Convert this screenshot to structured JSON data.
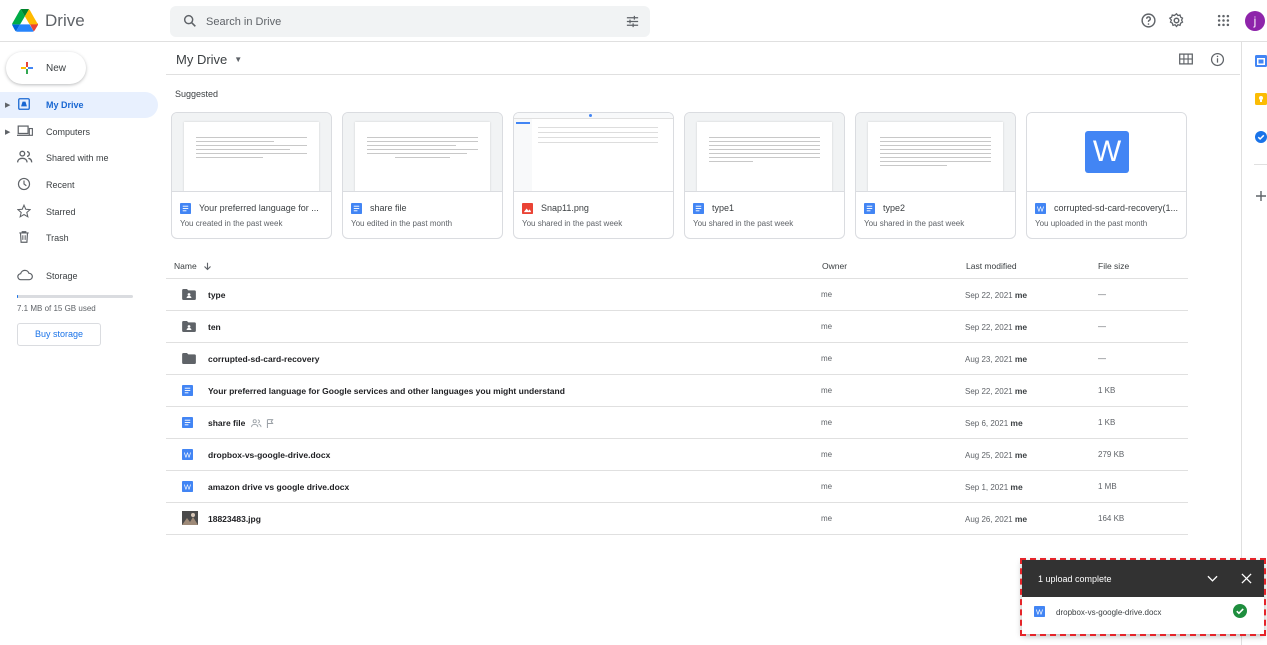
{
  "app": {
    "name": "Drive"
  },
  "search": {
    "placeholder": "Search in Drive"
  },
  "user": {
    "initial": "j"
  },
  "sidebar": {
    "new_label": "New",
    "items": [
      {
        "label": "My Drive"
      },
      {
        "label": "Computers"
      },
      {
        "label": "Shared with me"
      },
      {
        "label": "Recent"
      },
      {
        "label": "Starred"
      },
      {
        "label": "Trash"
      },
      {
        "label": "Storage"
      }
    ],
    "storage_text": "7.1 MB of 15 GB used",
    "storage_fraction": 0.0005,
    "buy_label": "Buy storage"
  },
  "main": {
    "title": "My Drive",
    "suggested_label": "Suggested",
    "cards": [
      {
        "name": "Your preferred language for ...",
        "sub": "You created in the past week",
        "type": "doc"
      },
      {
        "name": "share file",
        "sub": "You edited in the past month",
        "type": "doc"
      },
      {
        "name": "Snap11.png",
        "sub": "You shared in the past week",
        "type": "image"
      },
      {
        "name": "type1",
        "sub": "You shared in the past week",
        "type": "doc"
      },
      {
        "name": "type2",
        "sub": "You shared in the past week",
        "type": "doc"
      },
      {
        "name": "corrupted-sd-card-recovery(1...",
        "sub": "You uploaded in the past month",
        "type": "word"
      }
    ],
    "columns": {
      "name": "Name",
      "owner": "Owner",
      "modified": "Last modified",
      "size": "File size"
    },
    "rows": [
      {
        "name": "type",
        "owner": "me",
        "date": "Sep 22, 2021",
        "by": "me",
        "size": "—",
        "type": "shared-folder"
      },
      {
        "name": "ten",
        "owner": "me",
        "date": "Sep 22, 2021",
        "by": "me",
        "size": "—",
        "type": "shared-folder"
      },
      {
        "name": "corrupted-sd-card-recovery",
        "owner": "me",
        "date": "Aug 23, 2021",
        "by": "me",
        "size": "—",
        "type": "folder"
      },
      {
        "name": "Your preferred language for Google services and other languages you might understand",
        "owner": "me",
        "date": "Sep 22, 2021",
        "by": "me",
        "size": "1 KB",
        "type": "doc"
      },
      {
        "name": "share file",
        "owner": "me",
        "date": "Sep 6, 2021",
        "by": "me",
        "size": "1 KB",
        "type": "doc"
      },
      {
        "name": "dropbox-vs-google-drive.docx",
        "owner": "me",
        "date": "Aug 25, 2021",
        "by": "me",
        "size": "279 KB",
        "type": "word"
      },
      {
        "name": "amazon drive vs google drive.docx",
        "owner": "me",
        "date": "Sep 1, 2021",
        "by": "me",
        "size": "1 MB",
        "type": "word"
      },
      {
        "name": "18823483.jpg",
        "owner": "me",
        "date": "Aug 26, 2021",
        "by": "me",
        "size": "164 KB",
        "type": "photo"
      }
    ]
  },
  "upload": {
    "title": "1 upload complete",
    "file": "dropbox-vs-google-drive.docx"
  },
  "colors": {
    "accent": "#1a73e8",
    "doc": "#4285f4",
    "success": "#1e8e3e",
    "highlight": "#e5252a"
  }
}
